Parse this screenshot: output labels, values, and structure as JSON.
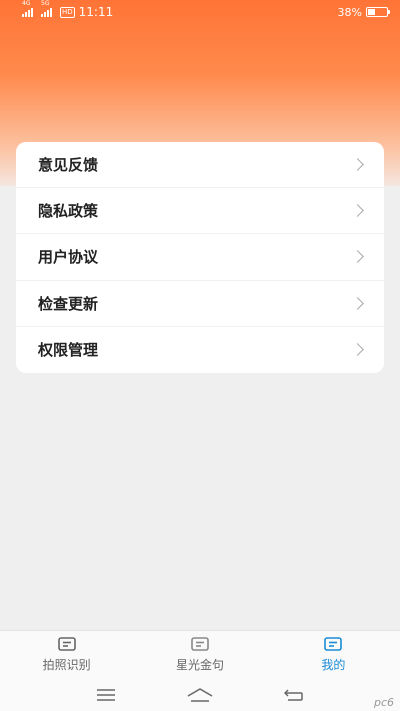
{
  "status_bar": {
    "net1": "4G",
    "net2": "5G",
    "hd": "HD",
    "time": "11:11",
    "battery_text": "38%",
    "battery_level": 0.38
  },
  "menu": {
    "items": [
      {
        "label": "意见反馈"
      },
      {
        "label": "隐私政策"
      },
      {
        "label": "用户协议"
      },
      {
        "label": "检查更新"
      },
      {
        "label": "权限管理"
      }
    ]
  },
  "tabbar": {
    "tabs": [
      {
        "label": "拍照识别",
        "icon": "message-square-icon"
      },
      {
        "label": "星光金句",
        "icon": "message-square-icon"
      },
      {
        "label": "我的",
        "icon": "message-square-icon"
      }
    ],
    "active_index": 2
  },
  "colors": {
    "accent": "#ff7436",
    "active_tab": "#1a8bd6"
  },
  "watermark": "pc6"
}
